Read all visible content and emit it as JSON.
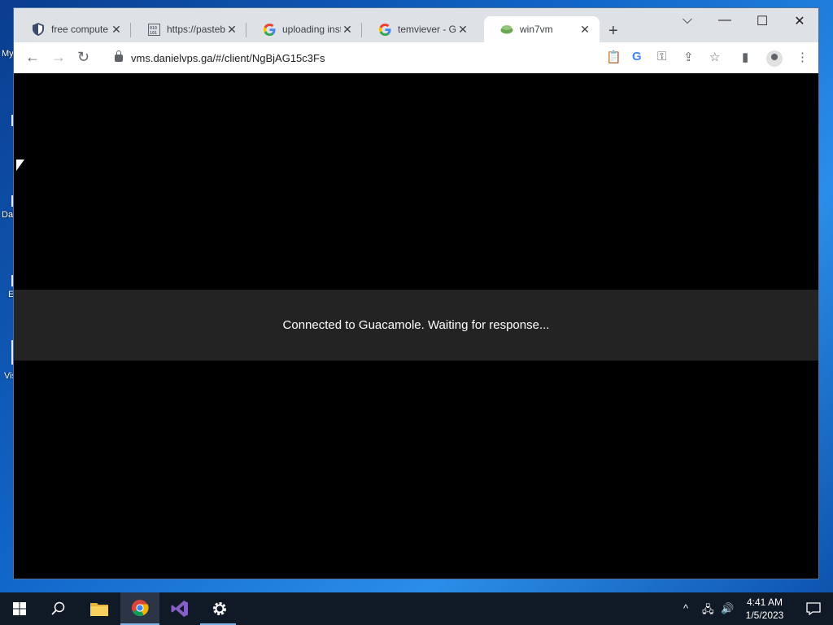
{
  "desktop": {
    "labels": [
      "My",
      "Da",
      "E",
      "Vis"
    ]
  },
  "tabs": [
    {
      "title": "free compute",
      "favicon": "shield-icon"
    },
    {
      "title": "https://pasteb",
      "favicon": "binary-icon"
    },
    {
      "title": "uploading inst",
      "favicon": "google-icon"
    },
    {
      "title": "temviever - Go",
      "favicon": "google-icon"
    },
    {
      "title": "win7vm",
      "favicon": "guacamole-icon",
      "active": true
    }
  ],
  "new_tab_label": "+",
  "address_bar": {
    "url": "vms.danielvps.ga/#/client/NgBjAG15c3Fs"
  },
  "page": {
    "status_message": "Connected to Guacamole. Waiting for response..."
  },
  "taskbar": {
    "time": "4:41 AM",
    "date": "1/5/2023"
  }
}
